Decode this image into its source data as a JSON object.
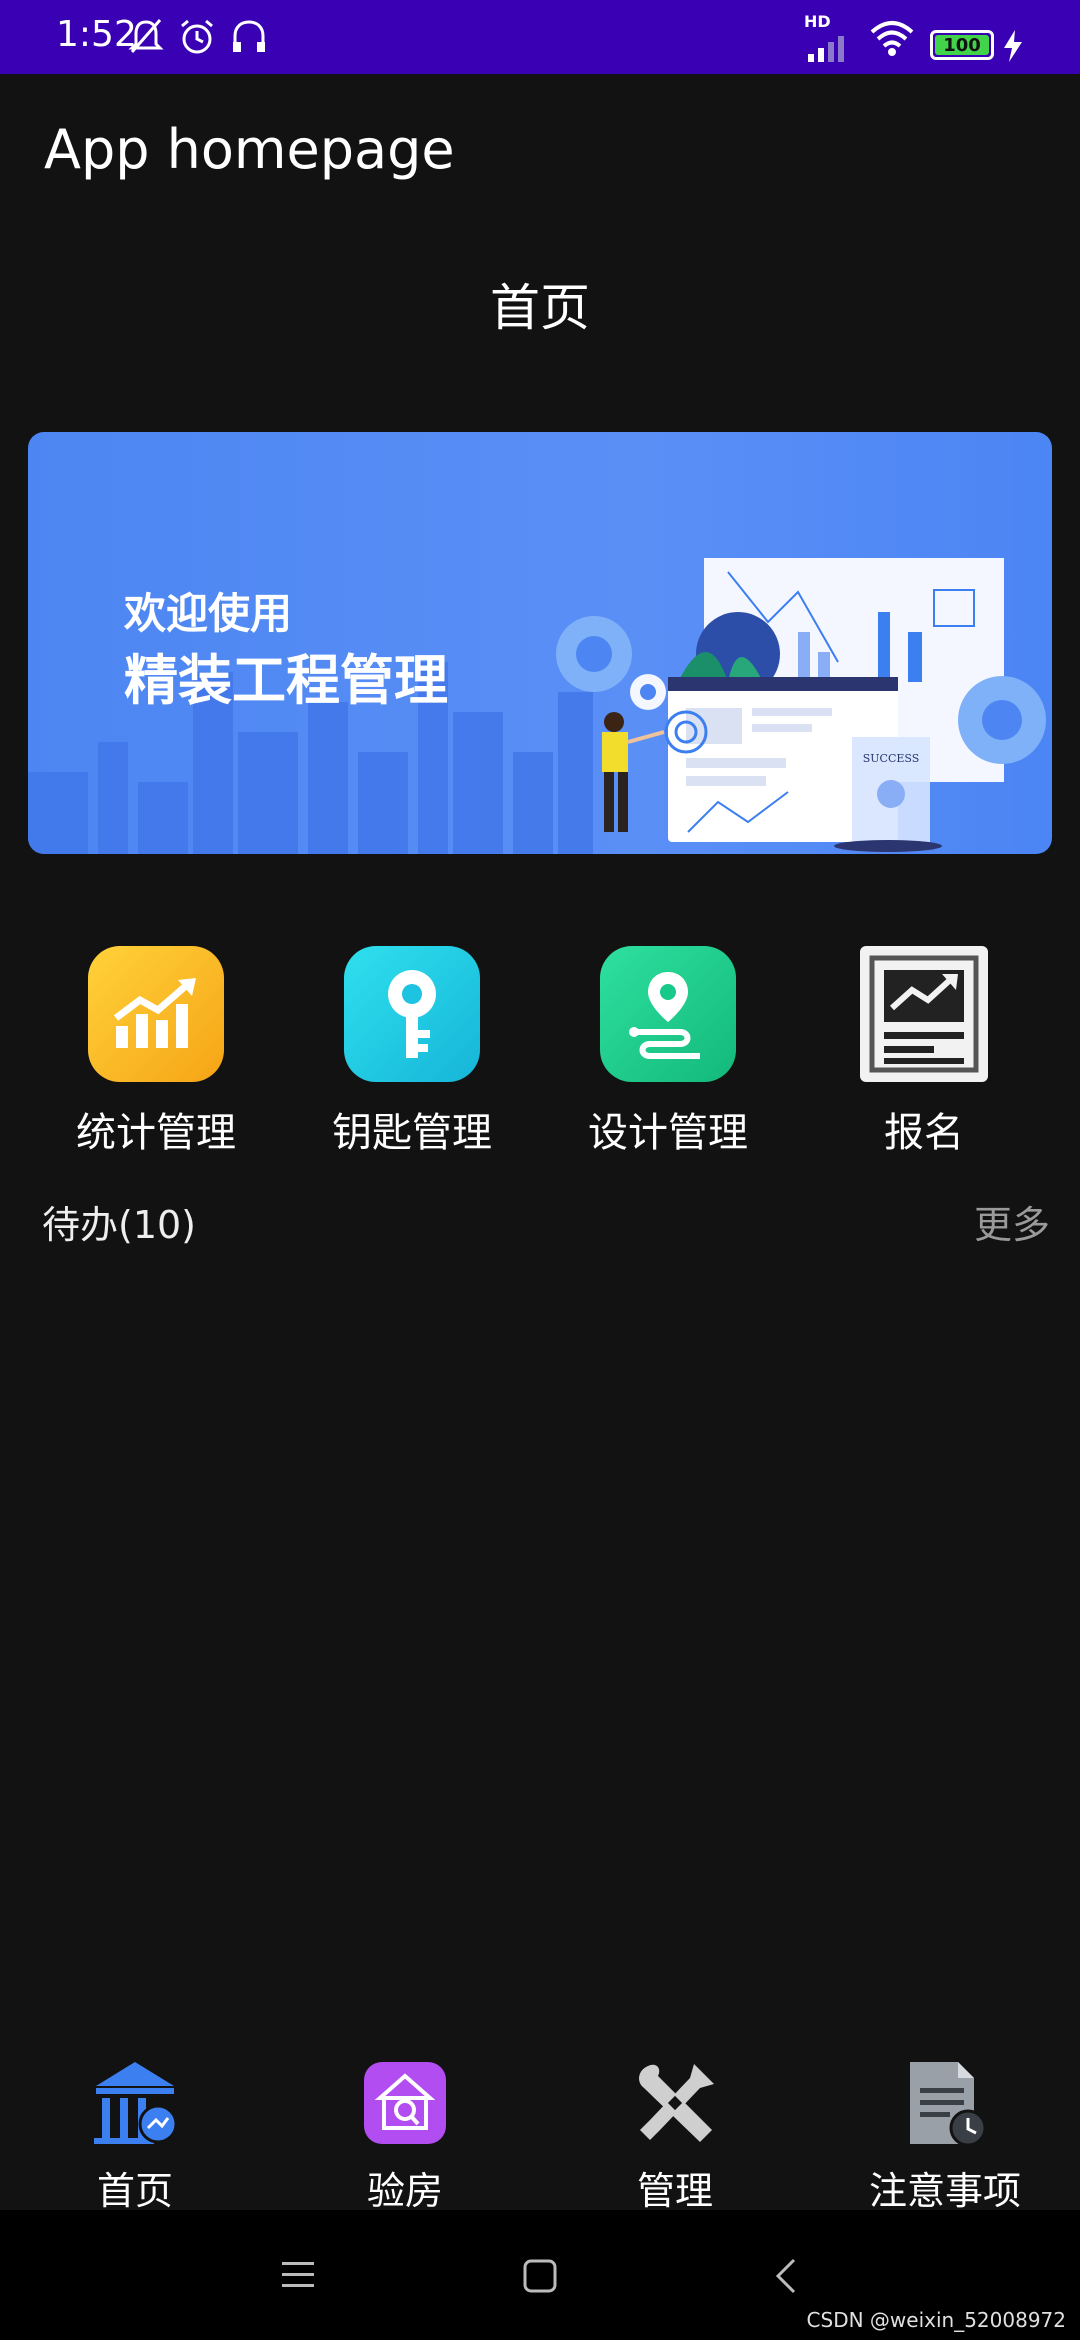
{
  "status_bar": {
    "time": "1:52",
    "network": "HD",
    "battery": "100",
    "icons": [
      "bell-off-icon",
      "alarm-icon",
      "headset-icon",
      "signal-icon",
      "wifi-icon",
      "battery-icon",
      "charging-icon"
    ]
  },
  "header": {
    "app_title": "App homepage",
    "page_title": "首页"
  },
  "banner": {
    "subtitle": "欢迎使用",
    "title": "精装工程管理",
    "badge_text": "SUCCESS"
  },
  "shortcuts": [
    {
      "label": "统计管理",
      "icon": "chart-growth-icon",
      "color": "#f7b91f"
    },
    {
      "label": "钥匙管理",
      "icon": "key-icon",
      "color": "#20c9e0"
    },
    {
      "label": "设计管理",
      "icon": "route-pin-icon",
      "color": "#18c98a"
    },
    {
      "label": "报名",
      "icon": "report-chart-icon",
      "color": "#f2f2f2"
    }
  ],
  "todo": {
    "title": "待办(10)",
    "more": "更多"
  },
  "tabbar": {
    "items": [
      {
        "label": "首页",
        "icon": "bank-icon",
        "color": "#3c7ff0"
      },
      {
        "label": "验房",
        "icon": "house-search-icon",
        "color": "#b24df2"
      },
      {
        "label": "管理",
        "icon": "tools-icon",
        "color": "#cfcfcf"
      },
      {
        "label": "注意事项",
        "icon": "document-clock-icon",
        "color": "#9aa0a8"
      }
    ]
  },
  "nav": {
    "icons": [
      "menu-icon",
      "home-square-icon",
      "back-icon"
    ]
  },
  "watermark": "CSDN @weixin_52008972"
}
